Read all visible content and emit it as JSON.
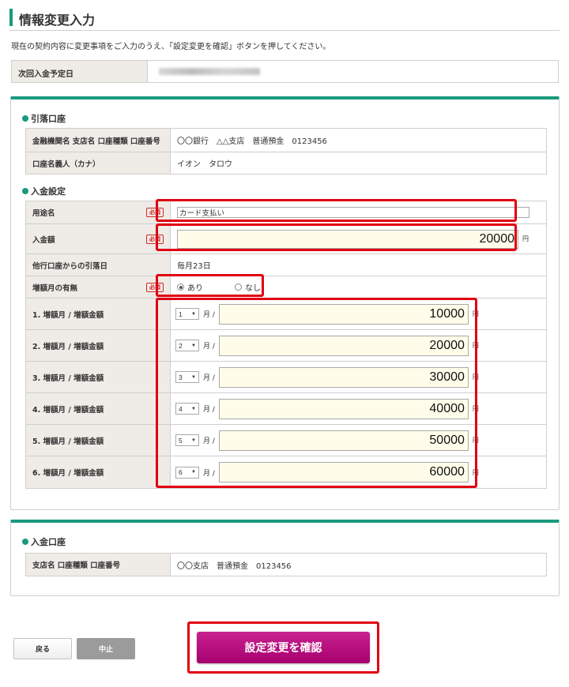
{
  "page": {
    "title": "情報変更入力",
    "intro": "現在の契約内容に変更事項をご入力のうえ、「設定変更を確認」ボタンを押してください。"
  },
  "next_payment": {
    "label": "次回入金予定日"
  },
  "debit_account": {
    "section_title": "引落口座",
    "rows": [
      {
        "label": "金融機関名 支店名 口座種類 口座番号",
        "value": "〇〇銀行　△△支店　普通預金　0123456"
      },
      {
        "label": "口座名義人（カナ）",
        "value": "イオン　タロウ"
      }
    ]
  },
  "deposit_settings": {
    "section_title": "入金設定",
    "required_badge": "必須",
    "purpose": {
      "label": "用途名",
      "value": "カード支払い"
    },
    "amount": {
      "label": "入金額",
      "value": "20000",
      "unit": "円"
    },
    "debit_date": {
      "label": "他行口座からの引落日",
      "value": "毎月23日"
    },
    "increase_flag": {
      "label": "増額月の有無",
      "option_yes": "あり",
      "option_no": "なし",
      "selected": "あり"
    },
    "month_suffix": "月 /",
    "unit": "円",
    "increases": [
      {
        "label": "1.  増額月 / 増額金額",
        "month": "1",
        "amount": "10000"
      },
      {
        "label": "2.  増額月 / 増額金額",
        "month": "2",
        "amount": "20000"
      },
      {
        "label": "3.  増額月 / 増額金額",
        "month": "3",
        "amount": "30000"
      },
      {
        "label": "4.  増額月 / 増額金額",
        "month": "4",
        "amount": "40000"
      },
      {
        "label": "5.  増額月 / 増額金額",
        "month": "5",
        "amount": "50000"
      },
      {
        "label": "6.  増額月 / 増額金額",
        "month": "6",
        "amount": "60000"
      }
    ]
  },
  "deposit_account": {
    "section_title": "入金口座",
    "rows": [
      {
        "label": "支店名 口座種類 口座番号",
        "value": "〇〇支店　普通預金　0123456"
      }
    ]
  },
  "buttons": {
    "back": "戻る",
    "stop": "中止",
    "confirm": "設定変更を確認"
  },
  "colors": {
    "accent": "#1a9a7c",
    "highlight": "#e00012",
    "confirm": "#b8117f",
    "label_bg": "#efebe6",
    "input_bg": "#fffdea"
  }
}
